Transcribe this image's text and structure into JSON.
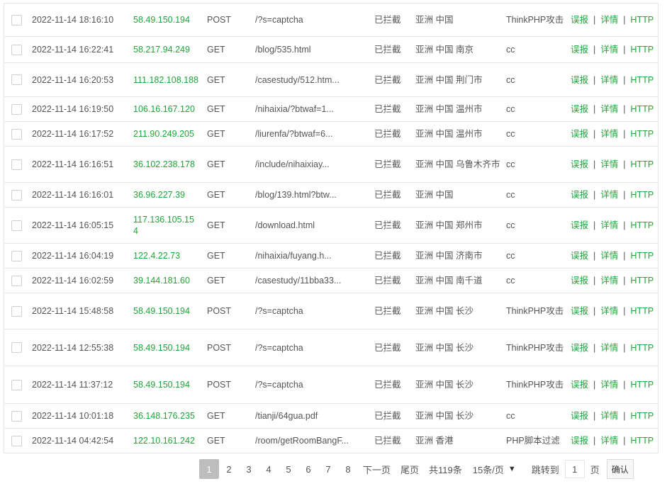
{
  "rows": [
    {
      "time": "2022-11-14 18:16:10",
      "ip": "58.49.150.194",
      "method": "POST",
      "url": "/?s=captcha",
      "status": "已拦截",
      "location": "亚洲 中国",
      "type": "ThinkPHP攻击"
    },
    {
      "time": "2022-11-14 16:22:41",
      "ip": "58.217.94.249",
      "method": "GET",
      "url": "/blog/535.html",
      "status": "已拦截",
      "location": "亚洲 中国 南京",
      "type": "cc"
    },
    {
      "time": "2022-11-14 16:20:53",
      "ip": "111.182.108.188",
      "method": "GET",
      "url": "/casestudy/512.htm...",
      "status": "已拦截",
      "location": "亚洲 中国 荆门市",
      "type": "cc"
    },
    {
      "time": "2022-11-14 16:19:50",
      "ip": "106.16.167.120",
      "method": "GET",
      "url": "/nihaixia/?btwaf=1...",
      "status": "已拦截",
      "location": "亚洲 中国 温州市",
      "type": "cc"
    },
    {
      "time": "2022-11-14 16:17:52",
      "ip": "211.90.249.205",
      "method": "GET",
      "url": "/liurenfa/?btwaf=6...",
      "status": "已拦截",
      "location": "亚洲 中国 温州市",
      "type": "cc"
    },
    {
      "time": "2022-11-14 16:16:51",
      "ip": "36.102.238.178",
      "method": "GET",
      "url": "/include/nihaixiay...",
      "status": "已拦截",
      "location": "亚洲 中国 乌鲁木齐市",
      "type": "cc"
    },
    {
      "time": "2022-11-14 16:16:01",
      "ip": "36.96.227.39",
      "method": "GET",
      "url": "/blog/139.html?btw...",
      "status": "已拦截",
      "location": "亚洲 中国",
      "type": "cc"
    },
    {
      "time": "2022-11-14 16:05:15",
      "ip": "117.136.105.154",
      "method": "GET",
      "url": "/download.html",
      "status": "已拦截",
      "location": "亚洲 中国 郑州市",
      "type": "cc"
    },
    {
      "time": "2022-11-14 16:04:19",
      "ip": "122.4.22.73",
      "method": "GET",
      "url": "/nihaixia/fuyang.h...",
      "status": "已拦截",
      "location": "亚洲 中国 济南市",
      "type": "cc"
    },
    {
      "time": "2022-11-14 16:02:59",
      "ip": "39.144.181.60",
      "method": "GET",
      "url": "/casestudy/11bba33...",
      "status": "已拦截",
      "location": "亚洲 中国 南千道",
      "type": "cc"
    },
    {
      "time": "2022-11-14 15:48:58",
      "ip": "58.49.150.194",
      "method": "POST",
      "url": "/?s=captcha",
      "status": "已拦截",
      "location": "亚洲 中国 长沙",
      "type": "ThinkPHP攻击"
    },
    {
      "time": "2022-11-14 12:55:38",
      "ip": "58.49.150.194",
      "method": "POST",
      "url": "/?s=captcha",
      "status": "已拦截",
      "location": "亚洲 中国 长沙",
      "type": "ThinkPHP攻击"
    },
    {
      "time": "2022-11-14 11:37:12",
      "ip": "58.49.150.194",
      "method": "POST",
      "url": "/?s=captcha",
      "status": "已拦截",
      "location": "亚洲 中国 长沙",
      "type": "ThinkPHP攻击"
    },
    {
      "time": "2022-11-14 10:01:18",
      "ip": "36.148.176.235",
      "method": "GET",
      "url": "/tianji/64gua.pdf",
      "status": "已拦截",
      "location": "亚洲 中国 长沙",
      "type": "cc"
    },
    {
      "time": "2022-11-14 04:42:54",
      "ip": "122.10.161.242",
      "method": "GET",
      "url": "/room/getRoomBangF...",
      "status": "已拦截",
      "location": "亚洲 香港",
      "type": "PHP脚本过滤"
    }
  ],
  "actions": {
    "report": "误报",
    "detail": "详情",
    "http": "HTTP",
    "separator": "|"
  },
  "pager": {
    "pages": [
      "1",
      "2",
      "3",
      "4",
      "5",
      "6",
      "7",
      "8"
    ],
    "current_page": "1",
    "next": "下一页",
    "last": "尾页",
    "total": "共119条",
    "page_size": "15条/页",
    "jump_label": "跳转到",
    "jump_value": "1",
    "page_unit": "页",
    "confirm": "确认"
  },
  "colors": {
    "link": "#20a53a",
    "current_page_bg": "#bdbdbd",
    "border": "#e6e6e6"
  }
}
